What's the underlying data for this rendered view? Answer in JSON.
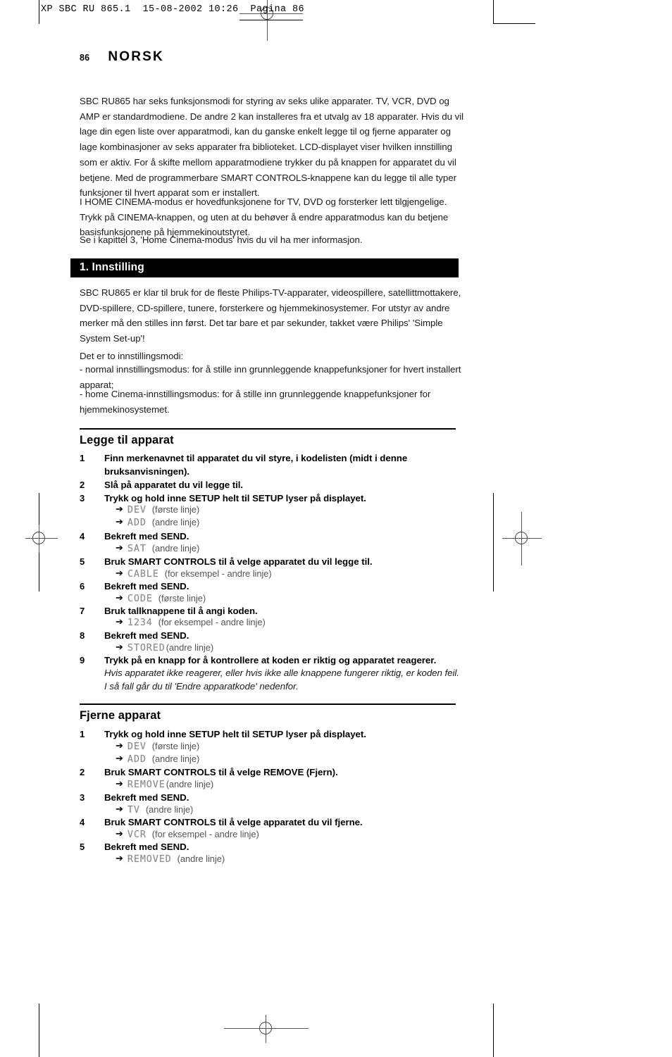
{
  "print_header": "XP SBC RU 865.1  15-08-2002 10:26  Pagina 86",
  "folio": "86",
  "page_title": "NORSK",
  "intro": {
    "paragraph_1": "SBC RU865 har seks funksjonsmodi for styring av seks ulike apparater. TV, VCR, DVD og AMP er standardmodiene. De andre 2 kan installeres fra et utvalg av 18 apparater. Hvis du vil lage din egen liste over apparatmodi, kan du ganske enkelt legge til og fjerne apparater og lage kombinasjoner av seks apparater fra biblioteket. LCD-displayet viser hvilken innstilling som er aktiv. For å skifte mellom apparatmodiene trykker du på knappen for apparatet du vil betjene. Med de programmerbare SMART CONTROLS-knappene kan du legge til alle typer funksjoner til hvert apparat som er installert.",
    "paragraph_2": "I HOME CINEMA-modus er hovedfunksjonene for TV, DVD og forsterker lett tilgjengelige. Trykk på CINEMA-knappen, og uten at du behøver å endre apparatmodus kan du betjene basisfunksjonene på hjemmekinoutstyret.",
    "paragraph_3": "Se i kapittel 3, 'Home Cinema-modus' hvis du vil ha mer informasjon."
  },
  "section_1": {
    "bar_label": "1. Innstilling",
    "paragraph_1": "SBC RU865 er klar til bruk for de fleste Philips-TV-apparater, videospillere, satellittmottakere, DVD-spillere, CD-spillere, tunere, forsterkere og hjemmekinosystemer. For utstyr av andre merker må den stilles inn først. Det tar bare et par sekunder, takket være Philips' 'Simple System Set-up'!",
    "paragraph_2": "Det er to innstillingsmodi:",
    "bullet_1": "- normal innstillingsmodus: for å stille inn grunnleggende knappefunksjoner for hvert installert apparat;",
    "bullet_2": "- home Cinema-innstillingsmodus: for å stille inn grunnleggende knappefunksjoner for hjemmekinosystemet."
  },
  "legge_til_apparat": {
    "heading": "Legge til apparat",
    "steps": [
      {
        "num": "1",
        "text": "Finn merkenavnet til apparatet du vil styre, i kodelisten (midt i denne bruksanvisningen)."
      },
      {
        "num": "2",
        "text": "Slå på apparatet du vil legge til."
      },
      {
        "num": "3",
        "text": "Trykk og hold inne SETUP helt til SETUP lyser på displayet."
      },
      {
        "num": "4",
        "text": "Bekreft med SEND."
      },
      {
        "num": "5",
        "text": "Bruk SMART CONTROLS til å velge apparatet du vil legge til."
      },
      {
        "num": "6",
        "text": "Bekreft med SEND."
      },
      {
        "num": "7",
        "text": "Bruk tallknappene til å angi koden."
      },
      {
        "num": "8",
        "text": "Bekreft med SEND."
      },
      {
        "num": "9",
        "text": "Trykk på en knapp for å kontrollere at koden er riktig og apparatet reagerer.",
        "italic": "Hvis apparatet ikke reagerer, eller hvis ikke alle knappene fungerer riktig, er koden feil. I så fall går du til 'Endre apparatkode' nedenfor."
      }
    ],
    "readouts": [
      {
        "value": "DEV",
        "note": "(første linje)"
      },
      {
        "value": "ADD",
        "note": "(andre linje)"
      },
      {
        "value": "SAT",
        "note": "(andre linje)"
      },
      {
        "value": "CABLE",
        "note": "(for eksempel - andre linje)"
      },
      {
        "value": "CODE",
        "note": "(første linje)"
      },
      {
        "value": "1234",
        "note": "(for eksempel - andre linje)"
      },
      {
        "value": "STORED",
        "note": "(andre linje)"
      }
    ]
  },
  "fjerne_apparat": {
    "heading": "Fjerne apparat",
    "steps": [
      {
        "num": "1",
        "text": "Trykk og hold inne SETUP helt til SETUP lyser på displayet."
      },
      {
        "num": "2",
        "text": "Bruk SMART CONTROLS til å velge REMOVE (Fjern)."
      },
      {
        "num": "3",
        "text": "Bekreft med SEND."
      },
      {
        "num": "4",
        "text": "Bruk SMART CONTROLS til å velge apparatet du vil fjerne."
      },
      {
        "num": "5",
        "text": "Bekreft med SEND."
      }
    ],
    "readouts": [
      {
        "value": "DEV",
        "note": "(første linje)"
      },
      {
        "value": "ADD",
        "note": "(andre linje)"
      },
      {
        "value": "REMOVE",
        "note": "(andre linje)"
      },
      {
        "value": "TV",
        "note": "(andre linje)"
      },
      {
        "value": "VCR",
        "note": "(for eksempel - andre linje)"
      },
      {
        "value": "REMOVED",
        "note": "(andre linje)"
      }
    ]
  },
  "icons": {
    "arrow": "➔"
  }
}
